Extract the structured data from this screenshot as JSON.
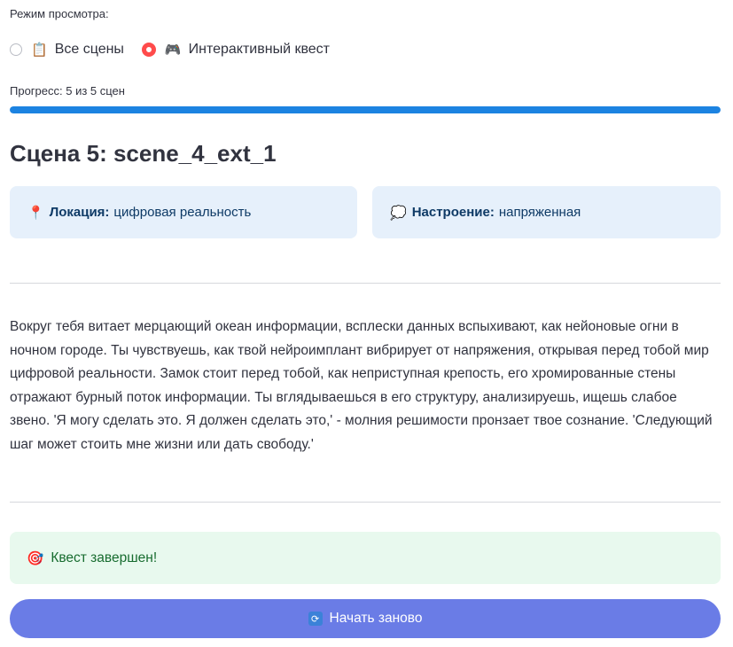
{
  "view_mode": {
    "label": "Режим просмотра:",
    "options": [
      {
        "icon": "clipboard-icon",
        "glyph": "📋",
        "label": "Все сцены",
        "selected": false
      },
      {
        "icon": "gamepad-icon",
        "glyph": "🎮",
        "label": "Интерактивный квест",
        "selected": true
      }
    ]
  },
  "progress": {
    "label": "Прогресс: 5 из 5 сцен",
    "current": 5,
    "total": 5,
    "fraction": 1.0,
    "color": "#1c83e1"
  },
  "scene": {
    "title": "Сцена 5: scene_4_ext_1",
    "location": {
      "icon": "pin-icon",
      "glyph": "📍",
      "label": "Локация:",
      "value": "цифровая реальность"
    },
    "mood": {
      "icon": "thought-bubble-icon",
      "glyph": "💭",
      "label": "Настроение:",
      "value": "напряженная"
    },
    "text": "Вокруг тебя витает мерцающий океан информации, всплески данных вспыхивают, как нейоновые огни в ночном городе. Ты чувствуешь, как твой нейроимплант вибрирует от напряжения, открывая перед тобой мир цифровой реальности. Замок стоит перед тобой, как неприступная крепость, его хромированные стены отражают бурный поток информации. Ты вглядываешься в его структуру, анализируешь, ищешь слабое звено. 'Я могу сделать это. Я должен сделать это,' - молния решимости пронзает твое сознание. 'Следующий шаг может стоить мне жизни или дать свободу.'"
  },
  "status": {
    "icon": "target-icon",
    "glyph": "🎯",
    "text": "Квест завершен!"
  },
  "restart": {
    "icon": "refresh-icon",
    "glyph": "🔄",
    "label": "Начать заново",
    "color": "#6a7ce6"
  }
}
